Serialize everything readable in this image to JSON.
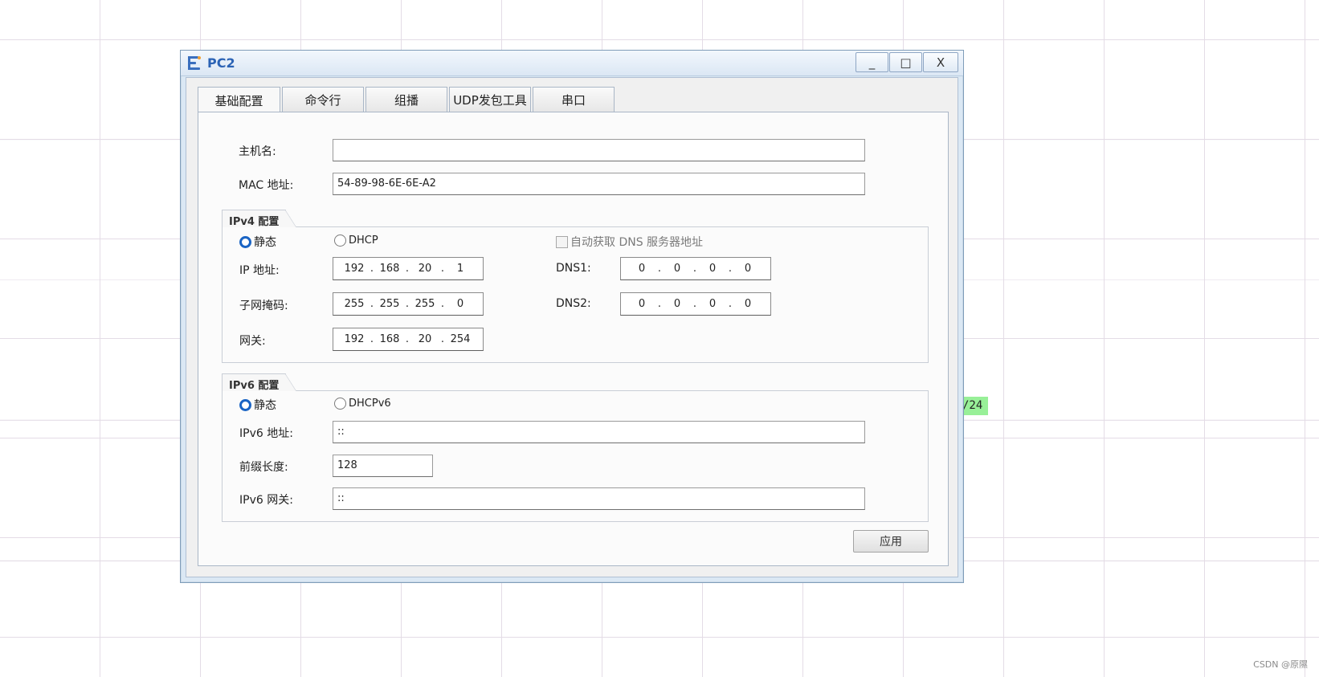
{
  "window": {
    "title": "PC2",
    "controls": {
      "minimize": "_",
      "maximize": "□",
      "close": "X"
    }
  },
  "tabs": [
    {
      "label": "基础配置",
      "active": true
    },
    {
      "label": "命令行",
      "active": false
    },
    {
      "label": "组播",
      "active": false
    },
    {
      "label": "UDP发包工具",
      "active": false
    },
    {
      "label": "串口",
      "active": false
    }
  ],
  "basic": {
    "hostname_label": "主机名:",
    "hostname_value": "",
    "mac_label": "MAC 地址:",
    "mac_value": "54-89-98-6E-6E-A2"
  },
  "ipv4": {
    "group_label": "IPv4 配置",
    "static_label": "静态",
    "static_checked": true,
    "dhcp_label": "DHCP",
    "dhcp_checked": false,
    "auto_dns_label": "自动获取 DNS 服务器地址",
    "auto_dns_checked": false,
    "ip_label": "IP 地址:",
    "ip": [
      "192",
      "168",
      "20",
      "1"
    ],
    "mask_label": "子网掩码:",
    "mask": [
      "255",
      "255",
      "255",
      "0"
    ],
    "gateway_label": "网关:",
    "gateway": [
      "192",
      "168",
      "20",
      "254"
    ],
    "dns1_label": "DNS1:",
    "dns1": [
      "0",
      "0",
      "0",
      "0"
    ],
    "dns2_label": "DNS2:",
    "dns2": [
      "0",
      "0",
      "0",
      "0"
    ]
  },
  "ipv6": {
    "group_label": "IPv6 配置",
    "static_label": "静态",
    "static_checked": true,
    "dhcp_label": "DHCPv6",
    "dhcp_checked": false,
    "addr_label": "IPv6 地址:",
    "addr_value": "::",
    "prefix_label": "前缀长度:",
    "prefix_value": "128",
    "gateway_label": "IPv6 网关:",
    "gateway_value": "::"
  },
  "apply_label": "应用",
  "background": {
    "tag_text": "/24",
    "tag_color": "#98f098",
    "watermark": "CSDN @原隰"
  },
  "colors": {
    "accent": "#1a64c4",
    "title_text": "#2b63b5",
    "window_frame": "#dbe8f4"
  }
}
